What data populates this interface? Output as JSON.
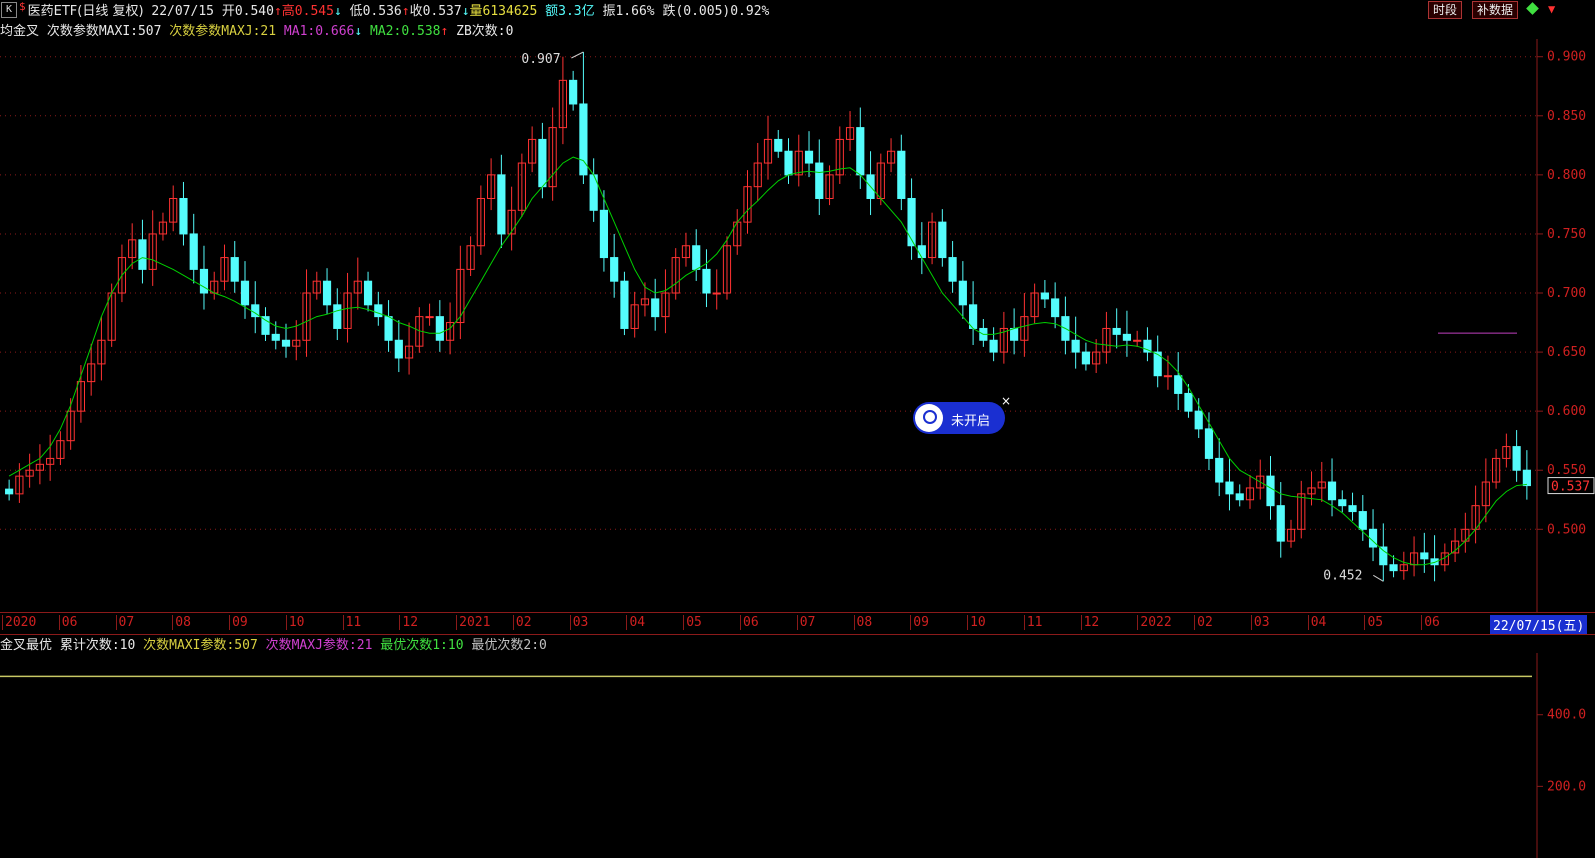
{
  "header": {
    "k_label": "K",
    "dollar": "$",
    "title": "医药ETF(日线 复权)",
    "date": "22/07/15",
    "open": "开0.540",
    "open_arrow": "↑",
    "high": "高0.545",
    "high_arrow": "↓",
    "low": "低0.536",
    "low_arrow": "↑",
    "close": "收0.537",
    "close_arrow": "↓",
    "volume": "量6134625",
    "amount": "额3.3亿",
    "amplitude": "振1.66%",
    "change": "跌(0.005)0.92%",
    "btn_period": "时段",
    "btn_fill": "补数据"
  },
  "indicator_bar": {
    "name": "均金叉",
    "param1": "次数参数MAXI:507",
    "param2": "次数参数MAXJ:21",
    "ma1": "MA1:0.666",
    "ma1_arrow": "↓",
    "ma2": "MA2:0.538",
    "ma2_arrow": "↑",
    "zb": "ZB次数:0"
  },
  "tooltip": {
    "label": "未开启",
    "close": "×"
  },
  "date_axis": {
    "labels": [
      "2020",
      "06",
      "07",
      "08",
      "09",
      "10",
      "11",
      "12",
      "2021",
      "02",
      "03",
      "04",
      "05",
      "06",
      "07",
      "08",
      "09",
      "10",
      "11",
      "12",
      "2022",
      "02",
      "03",
      "04",
      "05",
      "06"
    ],
    "current": "22/07/15(五)"
  },
  "sub_indicator_bar": {
    "name": "金叉最优",
    "total": "累计次数:10",
    "maxi": "次数MAXI参数:507",
    "maxj": "次数MAXJ参数:21",
    "best1": "最优次数1:10",
    "best2": "最优次数2:0"
  },
  "colors": {
    "up": "#ff3232",
    "down": "#54fcfc",
    "ma": "#00d000",
    "ma1_line": "#c040c0",
    "grid": "#8b1a1a",
    "sub_line": "#c8c864",
    "param_yellow": "#d8d040",
    "param_magenta": "#d040d0",
    "param_green": "#40e040"
  },
  "chart_data": {
    "type": "candlestick",
    "y_axis_labels": [
      "0.900",
      "0.850",
      "0.800",
      "0.750",
      "0.700",
      "0.650",
      "0.600",
      "0.550",
      "0.500"
    ],
    "y_ticks": [
      0.9,
      0.85,
      0.8,
      0.75,
      0.7,
      0.65,
      0.6,
      0.55,
      0.5
    ],
    "ylim": [
      0.43,
      0.915
    ],
    "current_price_label": "0.537",
    "max_label": "0.907",
    "min_label": "0.452",
    "ma1_value": 0.666,
    "closes": [
      0.53,
      0.545,
      0.55,
      0.555,
      0.56,
      0.575,
      0.6,
      0.625,
      0.64,
      0.66,
      0.7,
      0.73,
      0.745,
      0.72,
      0.75,
      0.76,
      0.78,
      0.75,
      0.72,
      0.7,
      0.71,
      0.73,
      0.71,
      0.69,
      0.68,
      0.665,
      0.66,
      0.655,
      0.66,
      0.7,
      0.71,
      0.69,
      0.67,
      0.7,
      0.71,
      0.69,
      0.68,
      0.66,
      0.645,
      0.655,
      0.68,
      0.68,
      0.66,
      0.675,
      0.72,
      0.74,
      0.78,
      0.8,
      0.75,
      0.77,
      0.81,
      0.83,
      0.79,
      0.84,
      0.88,
      0.86,
      0.8,
      0.77,
      0.73,
      0.71,
      0.67,
      0.69,
      0.695,
      0.68,
      0.7,
      0.73,
      0.74,
      0.72,
      0.7,
      0.7,
      0.74,
      0.76,
      0.79,
      0.81,
      0.83,
      0.82,
      0.8,
      0.82,
      0.81,
      0.78,
      0.8,
      0.83,
      0.84,
      0.8,
      0.78,
      0.81,
      0.82,
      0.78,
      0.74,
      0.73,
      0.76,
      0.73,
      0.71,
      0.69,
      0.67,
      0.66,
      0.65,
      0.67,
      0.66,
      0.68,
      0.7,
      0.695,
      0.68,
      0.66,
      0.65,
      0.64,
      0.65,
      0.67,
      0.665,
      0.66,
      0.66,
      0.65,
      0.63,
      0.63,
      0.615,
      0.6,
      0.585,
      0.56,
      0.54,
      0.53,
      0.525,
      0.535,
      0.545,
      0.52,
      0.49,
      0.5,
      0.53,
      0.535,
      0.54,
      0.525,
      0.52,
      0.515,
      0.5,
      0.485,
      0.47,
      0.465,
      0.47,
      0.48,
      0.475,
      0.47,
      0.48,
      0.49,
      0.5,
      0.52,
      0.54,
      0.56,
      0.57,
      0.55,
      0.537
    ],
    "ma": [
      0.545,
      0.55,
      0.555,
      0.56,
      0.57,
      0.585,
      0.605,
      0.63,
      0.655,
      0.68,
      0.7,
      0.715,
      0.725,
      0.73,
      0.728,
      0.724,
      0.72,
      0.715,
      0.71,
      0.705,
      0.7,
      0.697,
      0.693,
      0.688,
      0.683,
      0.677,
      0.672,
      0.67,
      0.672,
      0.676,
      0.68,
      0.682,
      0.685,
      0.687,
      0.688,
      0.686,
      0.683,
      0.68,
      0.675,
      0.672,
      0.668,
      0.666,
      0.666,
      0.67,
      0.68,
      0.695,
      0.71,
      0.725,
      0.74,
      0.752,
      0.765,
      0.78,
      0.79,
      0.8,
      0.81,
      0.815,
      0.812,
      0.8,
      0.78,
      0.76,
      0.74,
      0.72,
      0.705,
      0.7,
      0.702,
      0.708,
      0.715,
      0.72,
      0.725,
      0.733,
      0.745,
      0.76,
      0.77,
      0.778,
      0.787,
      0.795,
      0.8,
      0.802,
      0.803,
      0.802,
      0.803,
      0.805,
      0.806,
      0.8,
      0.79,
      0.78,
      0.77,
      0.76,
      0.745,
      0.73,
      0.715,
      0.7,
      0.69,
      0.68,
      0.67,
      0.665,
      0.665,
      0.667,
      0.67,
      0.672,
      0.674,
      0.675,
      0.674,
      0.67,
      0.665,
      0.66,
      0.657,
      0.656,
      0.655,
      0.656,
      0.655,
      0.652,
      0.648,
      0.642,
      0.633,
      0.62,
      0.605,
      0.59,
      0.575,
      0.56,
      0.55,
      0.545,
      0.54,
      0.535,
      0.53,
      0.528,
      0.527,
      0.526,
      0.525,
      0.52,
      0.514,
      0.506,
      0.498,
      0.49,
      0.482,
      0.476,
      0.472,
      0.47,
      0.47,
      0.472,
      0.476,
      0.482,
      0.49,
      0.5,
      0.512,
      0.524,
      0.532,
      0.537,
      0.538
    ],
    "sub_y_axis_labels": [
      "400.0",
      "200.0"
    ],
    "sub_y_ticks": [
      400,
      200
    ],
    "sub_ylim": [
      0,
      550
    ],
    "sub_series_value": 507
  }
}
